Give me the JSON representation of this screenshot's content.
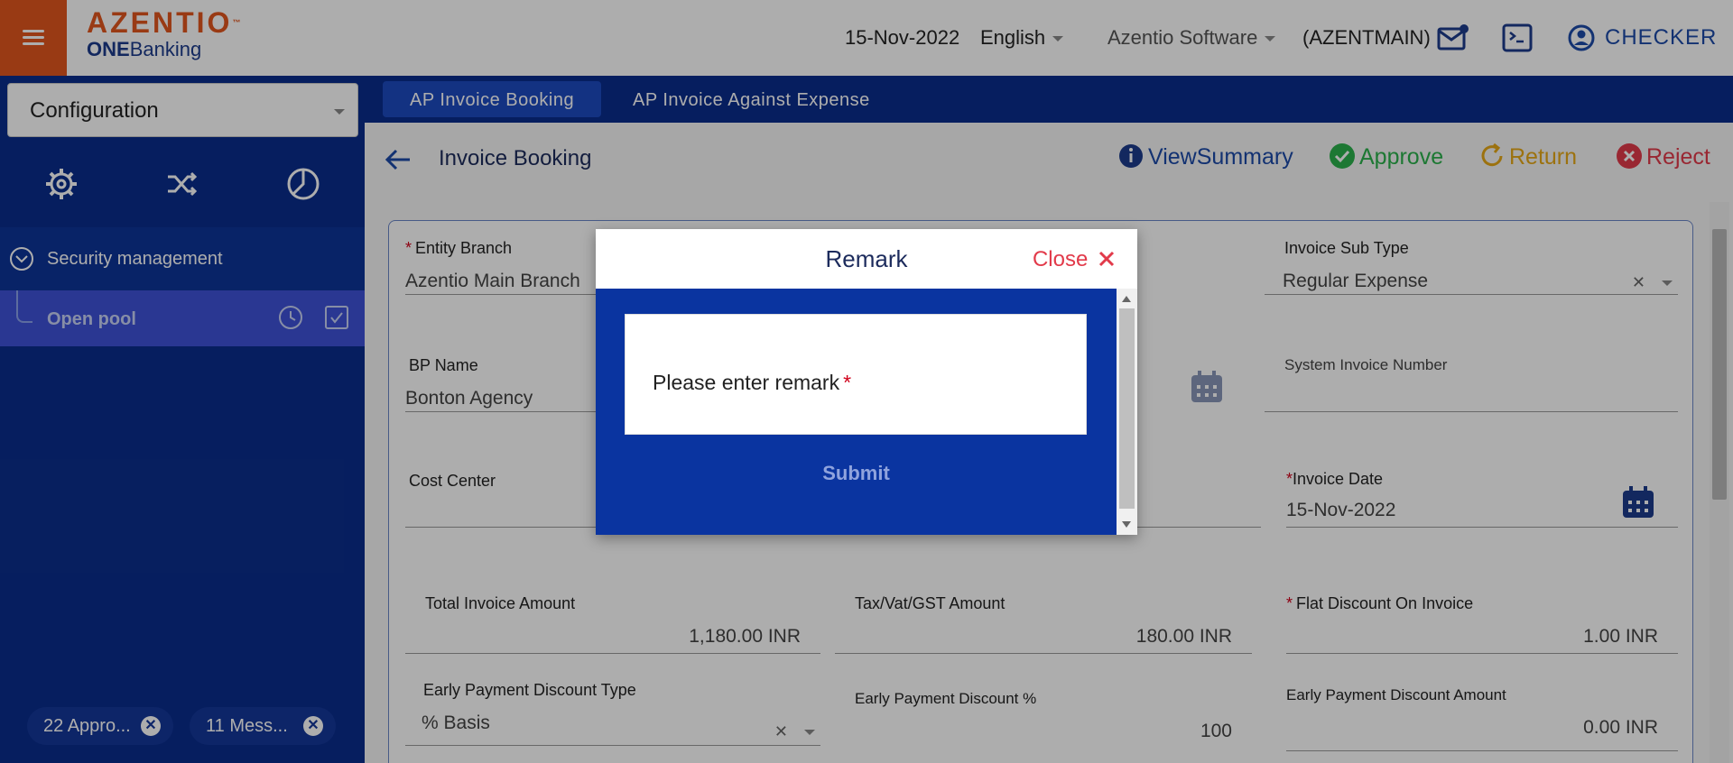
{
  "header": {
    "logo_brand": "AZENTIO",
    "logo_tm": "™",
    "logo_sub_bold": "ONE",
    "logo_sub": "Banking",
    "date": "15-Nov-2022",
    "language": "English",
    "company": "Azentio Software",
    "entity_code": "(AZENTMAIN)",
    "user": "CHECKER"
  },
  "sidebar": {
    "config_select": "Configuration",
    "tabs": [
      "gear-icon",
      "shuffle-icon",
      "pie-chart-icon"
    ],
    "tree": {
      "group_label": "Security management",
      "item_label": "Open pool"
    },
    "chips": [
      {
        "label": "22 Appro..."
      },
      {
        "label": "11 Mess..."
      }
    ]
  },
  "main": {
    "tabs": [
      {
        "label": "AP Invoice Booking",
        "active": true
      },
      {
        "label": "AP Invoice Against Expense",
        "active": false
      }
    ],
    "page_title": "Invoice Booking",
    "actions": {
      "view_summary": "ViewSummary",
      "approve": "Approve",
      "return": "Return",
      "reject": "Reject"
    },
    "form": {
      "entity_branch": {
        "label": "Entity Branch",
        "value": "Azentio Main Branch"
      },
      "invoice_sub_type": {
        "label": "Invoice Sub Type",
        "value": "Regular Expense"
      },
      "bp_name": {
        "label": "BP Name",
        "value": "Bonton Agency"
      },
      "system_invoice_number": {
        "label": "System Invoice Number",
        "value": ""
      },
      "cost_center": {
        "label": "Cost Center",
        "value": ""
      },
      "invoice_date": {
        "label": "Invoice Date",
        "value": "15-Nov-2022"
      },
      "total_invoice_amount": {
        "label": "Total Invoice Amount",
        "value": "1,180.00 INR"
      },
      "tax_amount": {
        "label": "Tax/Vat/GST Amount",
        "value": "180.00 INR"
      },
      "flat_discount": {
        "label": "Flat Discount On Invoice",
        "value": "1.00 INR"
      },
      "early_payment_discount_type": {
        "label": "Early Payment Discount Type",
        "value": "% Basis"
      },
      "early_payment_discount_pct": {
        "label": "Early Payment Discount %",
        "value": "100"
      },
      "early_payment_discount_amount": {
        "label": "Early Payment Discount Amount",
        "value": "0.00 INR"
      }
    }
  },
  "modal": {
    "title": "Remark",
    "close_label": "Close",
    "remark_placeholder": "Please enter remark",
    "required_mark": "*",
    "submit_label": "Submit"
  },
  "colors": {
    "brand_orange": "#e2561e",
    "navy": "#0a2d8c",
    "approve_green": "#2bb24c",
    "return_yellow": "#e6a817",
    "reject_red": "#e23a4a",
    "info_blue": "#1c4aa8"
  }
}
